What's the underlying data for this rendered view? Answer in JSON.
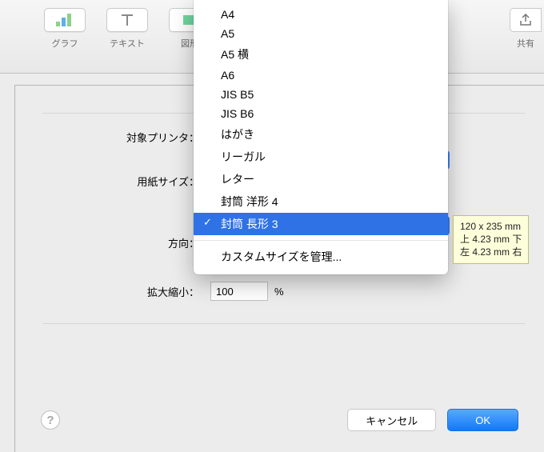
{
  "toolbar": {
    "items": [
      {
        "label": "グラフ",
        "icon": "chart"
      },
      {
        "label": "テキスト",
        "icon": "text"
      },
      {
        "label": "図形",
        "icon": "shape"
      }
    ],
    "share_label": "共有"
  },
  "printer": {
    "label": "対象プリンタ："
  },
  "papersize": {
    "label": "用紙サイズ：",
    "options": [
      "A4",
      "A5",
      "A5 横",
      "A6",
      "JIS B5",
      "JIS B6",
      "はがき",
      "リーガル",
      "レター",
      "封筒 洋形 4",
      "封筒 長形 3"
    ],
    "custom_label": "カスタムサイズを管理...",
    "selected": "封筒 長形 3"
  },
  "orientation": {
    "label": "方向："
  },
  "scale": {
    "label": "拡大縮小：",
    "value": "100",
    "unit": "%"
  },
  "tooltip": {
    "line1": "120 x 235 mm",
    "line2": "上 4.23 mm 下",
    "line3": "左 4.23 mm 右"
  },
  "buttons": {
    "cancel": "キャンセル",
    "ok": "OK"
  }
}
